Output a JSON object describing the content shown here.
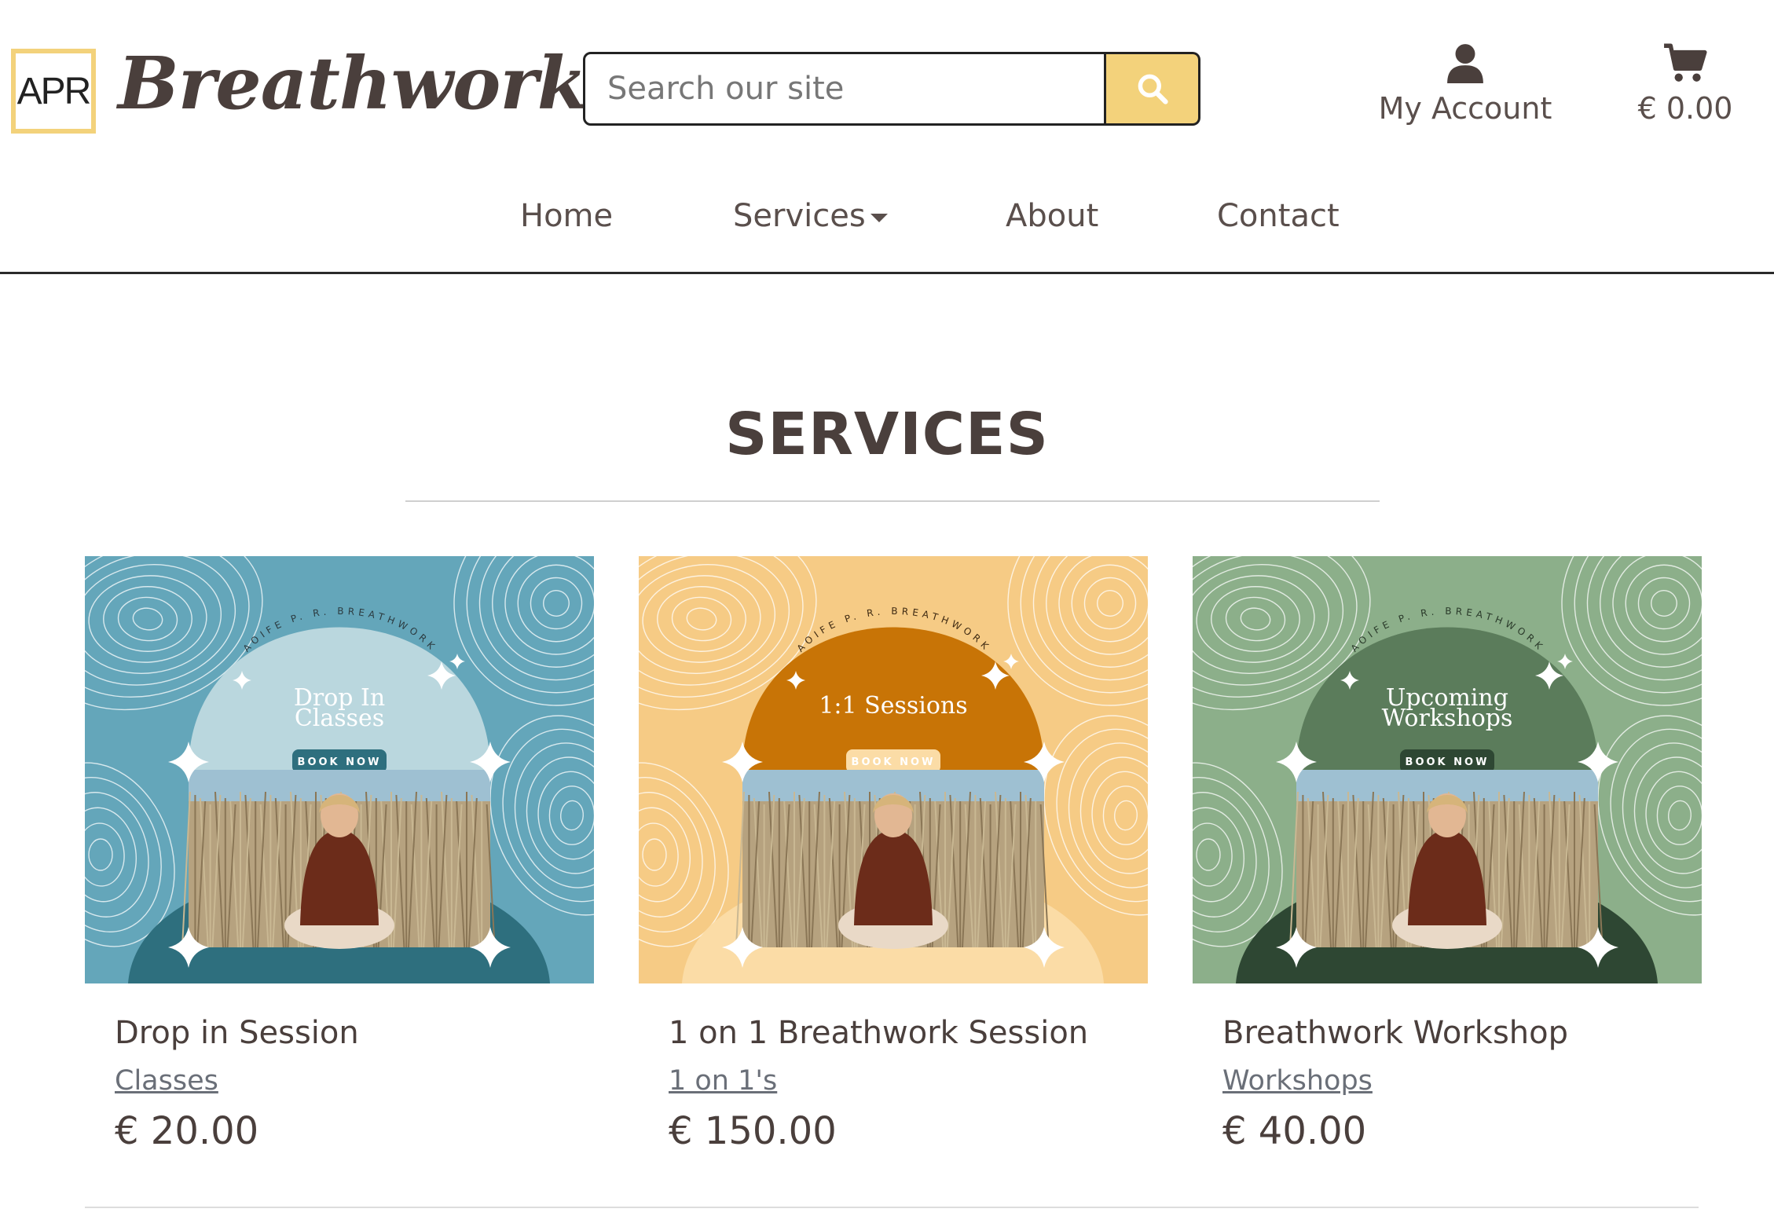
{
  "brand": {
    "badge": "APR",
    "name": "Breathwork",
    "accent": "#f3d27b"
  },
  "search": {
    "placeholder": "Search our site"
  },
  "header": {
    "account_label": "My Account",
    "cart_total": "€ 0.00"
  },
  "nav": {
    "home": "Home",
    "services": "Services",
    "about": "About",
    "contact": "Contact"
  },
  "page": {
    "title": "SERVICES"
  },
  "cards": [
    {
      "name": "Drop in Session",
      "category": "Classes",
      "price": "€ 20.00",
      "poster": {
        "arc": "AOIFE P. R. BREATHWORK",
        "title": [
          "Drop In",
          "Classes"
        ],
        "button": "BOOK NOW",
        "bg": "#64a6ba",
        "arch": "#bad7de",
        "base": "#2e6f7e",
        "pill": "#2e6f7e",
        "pill_text": "#ffffff",
        "arc_color": "#2c3b40"
      }
    },
    {
      "name": "1 on 1 Breathwork Session",
      "category": "1 on 1's",
      "price": "€ 150.00",
      "poster": {
        "arc": "AOIFE P. R. BREATHWORK",
        "title": [
          "1:1 Sessions"
        ],
        "button": "BOOK NOW",
        "bg": "#f6cb85",
        "arch": "#c87406",
        "base": "#fbdca6",
        "pill": "#fbdca6",
        "pill_text": "#ffffff",
        "arc_color": "#3f2a12"
      }
    },
    {
      "name": "Breathwork Workshop",
      "category": "Workshops",
      "price": "€ 40.00",
      "poster": {
        "arc": "AOIFE P. R. BREATHWORK",
        "title": [
          "Upcoming",
          "Workshops"
        ],
        "button": "BOOK NOW",
        "bg": "#8caf8a",
        "arch": "#5b7c5b",
        "base": "#2e4733",
        "pill": "#2e4733",
        "pill_text": "#ffffff",
        "arc_color": "#2a3a2a"
      }
    }
  ]
}
